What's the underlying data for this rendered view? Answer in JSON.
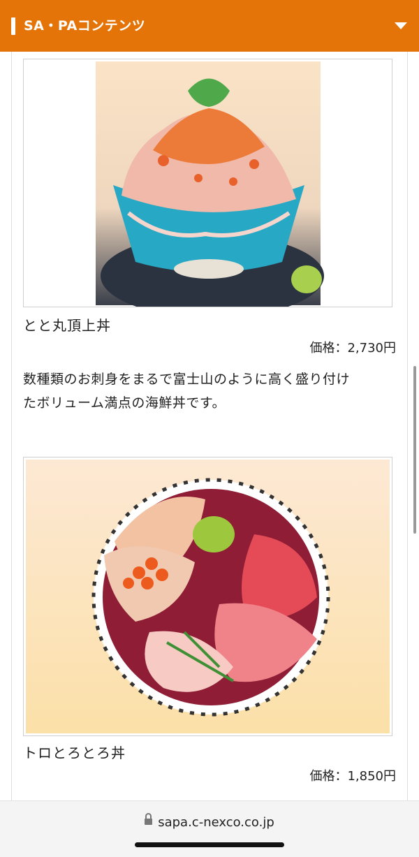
{
  "header": {
    "title": "SA・PAコンテンツ"
  },
  "items": [
    {
      "name": "とと丸頂上丼",
      "price": "価格：2,730円",
      "description_line1": "数種類のお刺身をまるで富士山のように高く盛り付け",
      "description_line2": "たボリューム満点の海鮮丼です。",
      "image_icon": "seafood-bowl-tall-image"
    },
    {
      "name": "トロとろとろ丼",
      "price": "価格：1,850円",
      "image_icon": "tuna-bowl-image"
    }
  ],
  "browser": {
    "url": "sapa.c-nexco.co.jp"
  },
  "colors": {
    "accent": "#e57408"
  }
}
